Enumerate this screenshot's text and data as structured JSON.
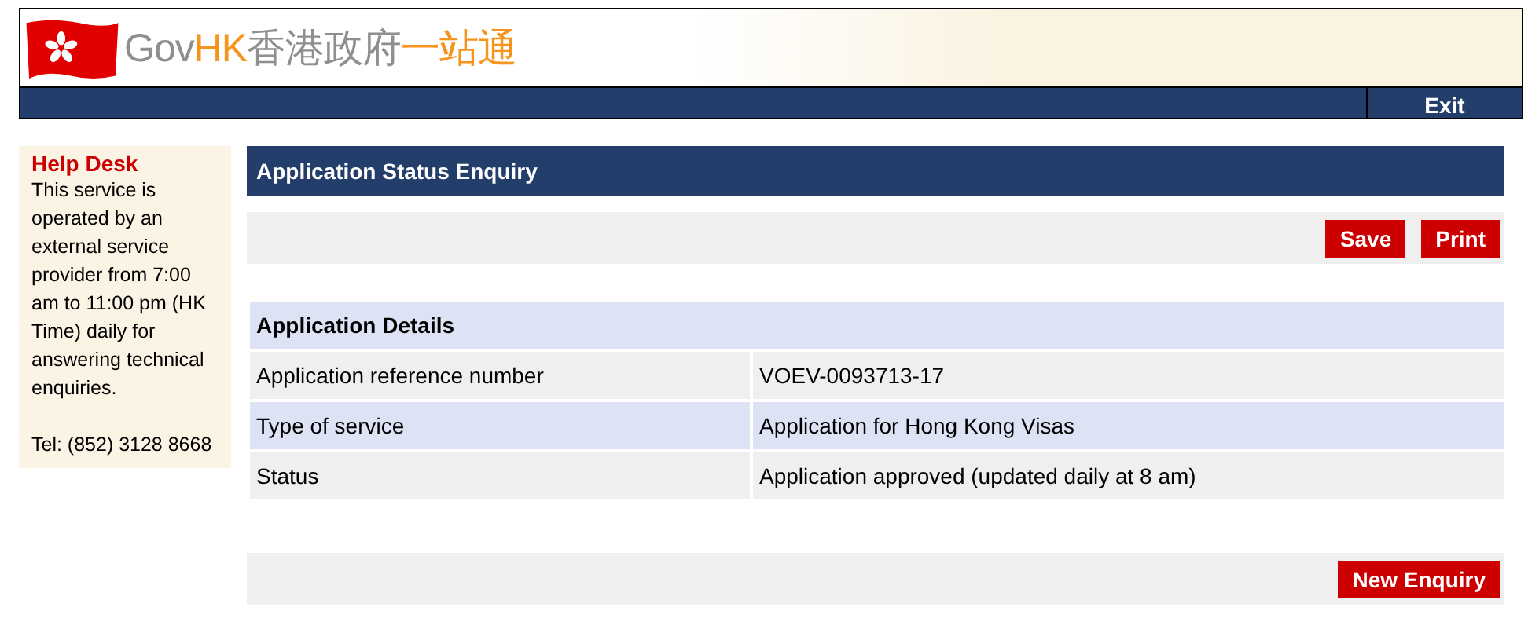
{
  "header": {
    "logo": [
      {
        "text": "Gov",
        "color": "#8f8f8f"
      },
      {
        "text": "HK",
        "color": "#f7941d"
      },
      {
        "text": "香港政府",
        "color": "#8f8f8f"
      },
      {
        "text": "一站通",
        "color": "#f7941d"
      }
    ],
    "nav": [
      {
        "label": "Exit"
      }
    ]
  },
  "help_desk": {
    "title": "Help Desk",
    "text": "This service is operated by an external service provider from 7:00 am to 11:00 pm (HK Time) daily for answering technical enquiries.",
    "tel": "Tel: (852) 3128 8668"
  },
  "page_title": "Application Status Enquiry",
  "toolbar": {
    "buttons": [
      "Save",
      "Print"
    ]
  },
  "details": {
    "heading": "Application Details",
    "rows": [
      {
        "label": "Application reference number",
        "value": "VOEV-0093713-17"
      },
      {
        "label": "Type of service",
        "value": "Application for Hong Kong Visas"
      },
      {
        "label": "Status",
        "value": "Application approved (updated daily at 8 am)"
      }
    ]
  },
  "footer_bar": {
    "buttons": [
      "New Enquiry"
    ]
  }
}
